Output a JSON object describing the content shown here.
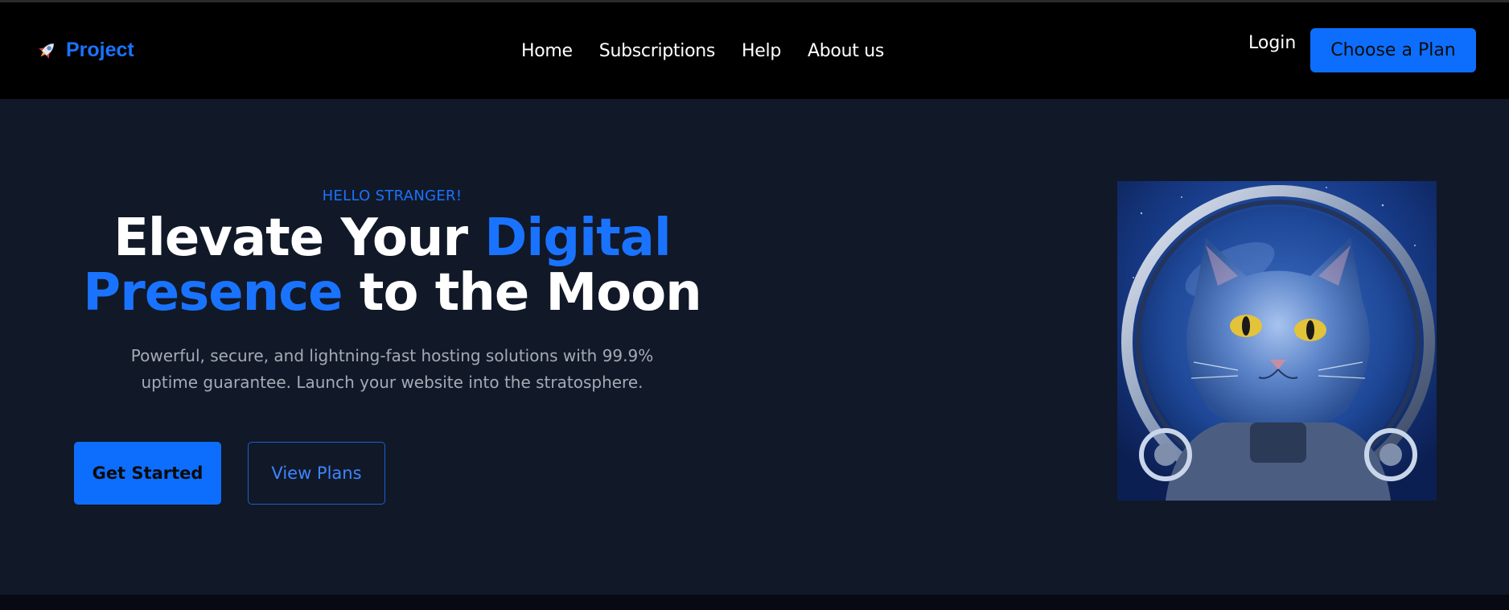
{
  "brand": {
    "name": "Project",
    "icon": "rocket-icon"
  },
  "nav": {
    "items": [
      {
        "label": "Home"
      },
      {
        "label": "Subscriptions"
      },
      {
        "label": "Help"
      },
      {
        "label": "About us"
      }
    ],
    "login_label": "Login",
    "cta_label": "Choose a Plan"
  },
  "hero": {
    "eyebrow": "HELLO STRANGER!",
    "title_part1": "Elevate Your ",
    "title_accent1": "Digital",
    "title_accent2": "Presence",
    "title_part2": " to the Moon",
    "subtitle": "Powerful, secure, and lightning-fast hosting solutions with 99.9% uptime guarantee. Launch your website into the stratosphere.",
    "primary_button": "Get Started",
    "secondary_button": "View Plans"
  },
  "colors": {
    "accent": "#1a73ff",
    "button_blue": "#0d6efd",
    "header_bg": "#000000",
    "hero_bg": "#111827",
    "subtitle_text": "#a4abb6"
  }
}
